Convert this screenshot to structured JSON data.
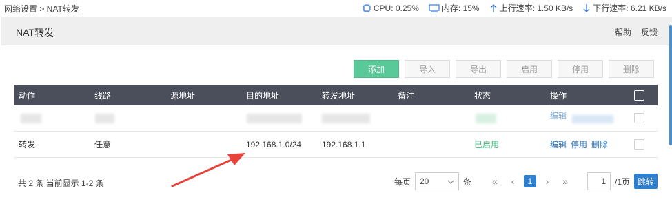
{
  "topbar": {
    "breadcrumb": "网络设置 > NAT转发",
    "cpu_label": "CPU: 0.25%",
    "mem_label": "内存: 15%",
    "up_label": "上行速率: 1.50 KB/s",
    "down_label": "下行速率: 6.21 KB/s"
  },
  "header": {
    "title": "NAT转发",
    "help": "帮助",
    "feedback": "反馈"
  },
  "toolbar": {
    "add": "添加",
    "import": "导入",
    "export": "导出",
    "enable": "启用",
    "disable": "停用",
    "delete": "删除"
  },
  "table": {
    "columns": [
      "动作",
      "线路",
      "源地址",
      "目的地址",
      "转发地址",
      "备注",
      "状态",
      "操作"
    ],
    "rows": [
      {
        "blurred": true,
        "edit_partial": "编辑"
      },
      {
        "action": "转发",
        "line": "任意",
        "source": "",
        "destination": "192.168.1.0/24",
        "forward": "192.168.1.1",
        "note": "",
        "status": "已启用",
        "ops": [
          "编辑",
          "停用",
          "删除"
        ]
      }
    ]
  },
  "pager": {
    "summary": "共 2 条 当前显示 1-2 条",
    "per_page_label": "每页",
    "per_page_value": "20",
    "per_page_unit": "条",
    "current_page": "1",
    "page_input": "1",
    "total_pages": "/1页",
    "jump": "跳转"
  },
  "colors": {
    "primary": "#59c99a",
    "header_bg": "#4b4f5c",
    "link": "#2a76c6",
    "status_ok": "#3cb878",
    "page_active": "#2f7fd1",
    "annotation_arrow": "#e8433a"
  }
}
